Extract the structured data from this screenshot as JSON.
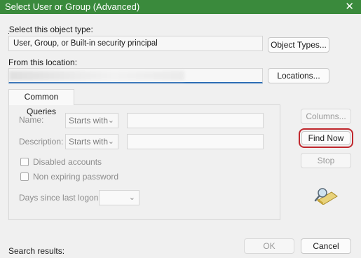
{
  "window": {
    "title": "Select User or Group (Advanced)",
    "close_glyph": "✕"
  },
  "object_type": {
    "label": "Select this object type:",
    "value": "User, Group, or Built-in security principal",
    "button": "Object Types..."
  },
  "location": {
    "label": "From this location:",
    "value": "",
    "button": "Locations..."
  },
  "common_queries": {
    "tab_label": "Common Queries",
    "name_label": "Name:",
    "name_mode": "Starts with",
    "name_value": "",
    "description_label": "Description:",
    "description_mode": "Starts with",
    "description_value": "",
    "disabled_accounts_label": "Disabled accounts",
    "disabled_accounts_checked": false,
    "non_expiring_password_label": "Non expiring password",
    "non_expiring_password_checked": false,
    "days_since_last_logon_label": "Days since last logon:",
    "days_since_last_logon_value": ""
  },
  "side_buttons": {
    "columns": "Columns...",
    "find_now": "Find Now",
    "stop": "Stop"
  },
  "footer": {
    "search_results_label": "Search results:",
    "ok": "OK",
    "cancel": "Cancel"
  },
  "icons": {
    "search_icon": "magnifier-over-folder"
  },
  "colors": {
    "titlebar": "#3a8a3c",
    "highlight": "#c0272d",
    "focus_underline": "#2c6db5"
  }
}
